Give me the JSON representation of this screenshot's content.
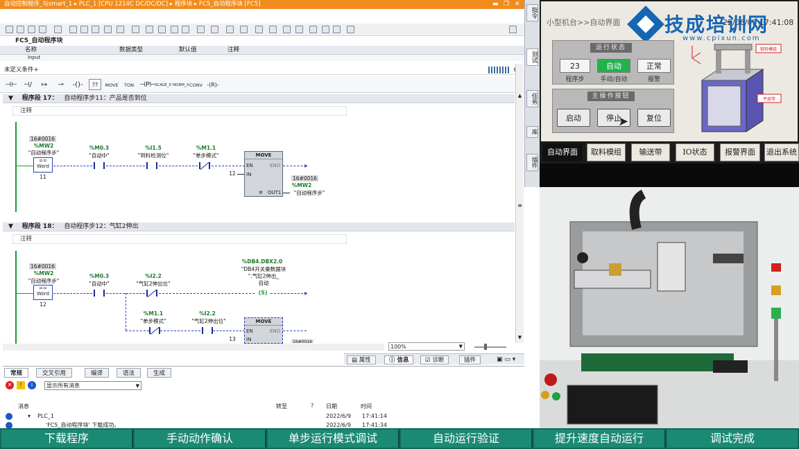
{
  "tia": {
    "breadcrumb": "自动控制程序_与smart_1  ▸  PLC_1 [CPU 1214C DC/DC/DC]  ▸  程序块  ▸  FC5_自动程序块 [FC5]",
    "block_name": "FC5_自动程序块",
    "interface_cols": [
      "名称",
      "数据类型",
      "默认值",
      "注释"
    ],
    "interface_row": "Input",
    "undefined_cond": "未定义条件+",
    "instructions": [
      "MOVE",
      "TON",
      "SCALE_X",
      "NORM_X",
      "CONV"
    ],
    "zoom": "100%",
    "networks": [
      {
        "label": "程序段 17：",
        "title": "自动程序步11：产品是否到位",
        "comment": "注释",
        "cmp_const": "16#0016",
        "cmp_addr": "%MW2",
        "cmp_name": "\"自动程序步\"",
        "cmp_op": "==",
        "cmp_type": "Word",
        "cmp_in2": "11",
        "c1_addr": "%M0.3",
        "c1_name": "\"自动中\"",
        "c2_addr": "%I1.5",
        "c2_name": "\"到料检测位\"",
        "c3_addr": "%M1.1",
        "c3_name": "\"单步模式\"",
        "move_title": "MOVE",
        "move_en": "EN",
        "move_eno": "ENO",
        "move_in": "IN",
        "move_out": "OUT1",
        "move_in_val": "12",
        "out_const": "16#0016",
        "out_addr": "%MW2",
        "out_name": "\"自动程序步\""
      },
      {
        "label": "程序段 18：",
        "title": "自动程序步12：气缸2伸出",
        "comment": "注释",
        "cmp_const": "16#0016",
        "cmp_addr": "%MW2",
        "cmp_name": "\"自动程序步\"",
        "cmp_op": "==",
        "cmp_type": "Word",
        "cmp_in2": "12",
        "c1_addr": "%M0.3",
        "c1_name": "\"自动中\"",
        "c2_addr": "%I2.2",
        "c2_name": "\"气缸2伸出位\"",
        "coil_addr": "%DB4.DBX2.0",
        "coil_name1": "\"DB4开关量数据块",
        "coil_name2": "\".气缸2伸出_",
        "coil_name3": "自动",
        "coil_sym": "S",
        "b1_addr": "%M1.1",
        "b1_name": "\"单步模式\"",
        "b2_addr": "%I2.2",
        "b2_name": "\"气缸2伸出位\"",
        "move_title": "MOVE",
        "move_en": "EN",
        "move_eno": "ENO",
        "move_in": "IN",
        "move_in_val": "13",
        "out_const": "16#0016"
      }
    ],
    "prop_tabs": [
      "属性",
      "信息",
      "诊断",
      "插件"
    ],
    "info_tabs": [
      "常规",
      "交叉引用",
      "编译",
      "语法",
      "生成"
    ],
    "msg_filter": "显示所有消息",
    "msg_cols": [
      "消息",
      "转至",
      "?",
      "日期",
      "时间"
    ],
    "messages": [
      {
        "text": "PLC_1",
        "date": "2022/6/9",
        "time": "17:41:14"
      },
      {
        "text": "'FC5_自动程序块' 下载成功。",
        "date": "2022/6/9",
        "time": "17:41:34"
      }
    ],
    "side_tabs": [
      "指令",
      "测试",
      "任务",
      "库",
      "插件"
    ]
  },
  "hmi": {
    "title": "小型机台>>自动界面",
    "datetime": "22/06/09 17:41:08",
    "logo_text": "技成培训网",
    "logo_url": "www.cpixun.com",
    "status_group": "运行状态",
    "step_value": "23",
    "mode_value": "自动",
    "alarm_value": "正常",
    "step_caption": "程序步",
    "mode_caption": "手动/自动",
    "alarm_caption": "报警",
    "ops_group": "主操作按钮",
    "btn_start": "启动",
    "btn_stop": "停止",
    "btn_reset": "复位",
    "diagram_label1": "取料模组",
    "diagram_label2": "平皮带",
    "nav": [
      "自动界面",
      "取料模组",
      "输送带",
      "IO状态",
      "报警界面",
      "退出系统"
    ]
  },
  "steps": [
    "下载程序",
    "手动动作确认",
    "单步运行模式调试",
    "自动运行验证",
    "提升速度自动运行",
    "调试完成"
  ],
  "colors": {
    "tia_title": "#f08c1e",
    "ladder_green": "#1a9a3a",
    "hmi_auto": "#22b24c",
    "step_bar": "#1b8a72",
    "logo_blue": "#1766b3"
  }
}
